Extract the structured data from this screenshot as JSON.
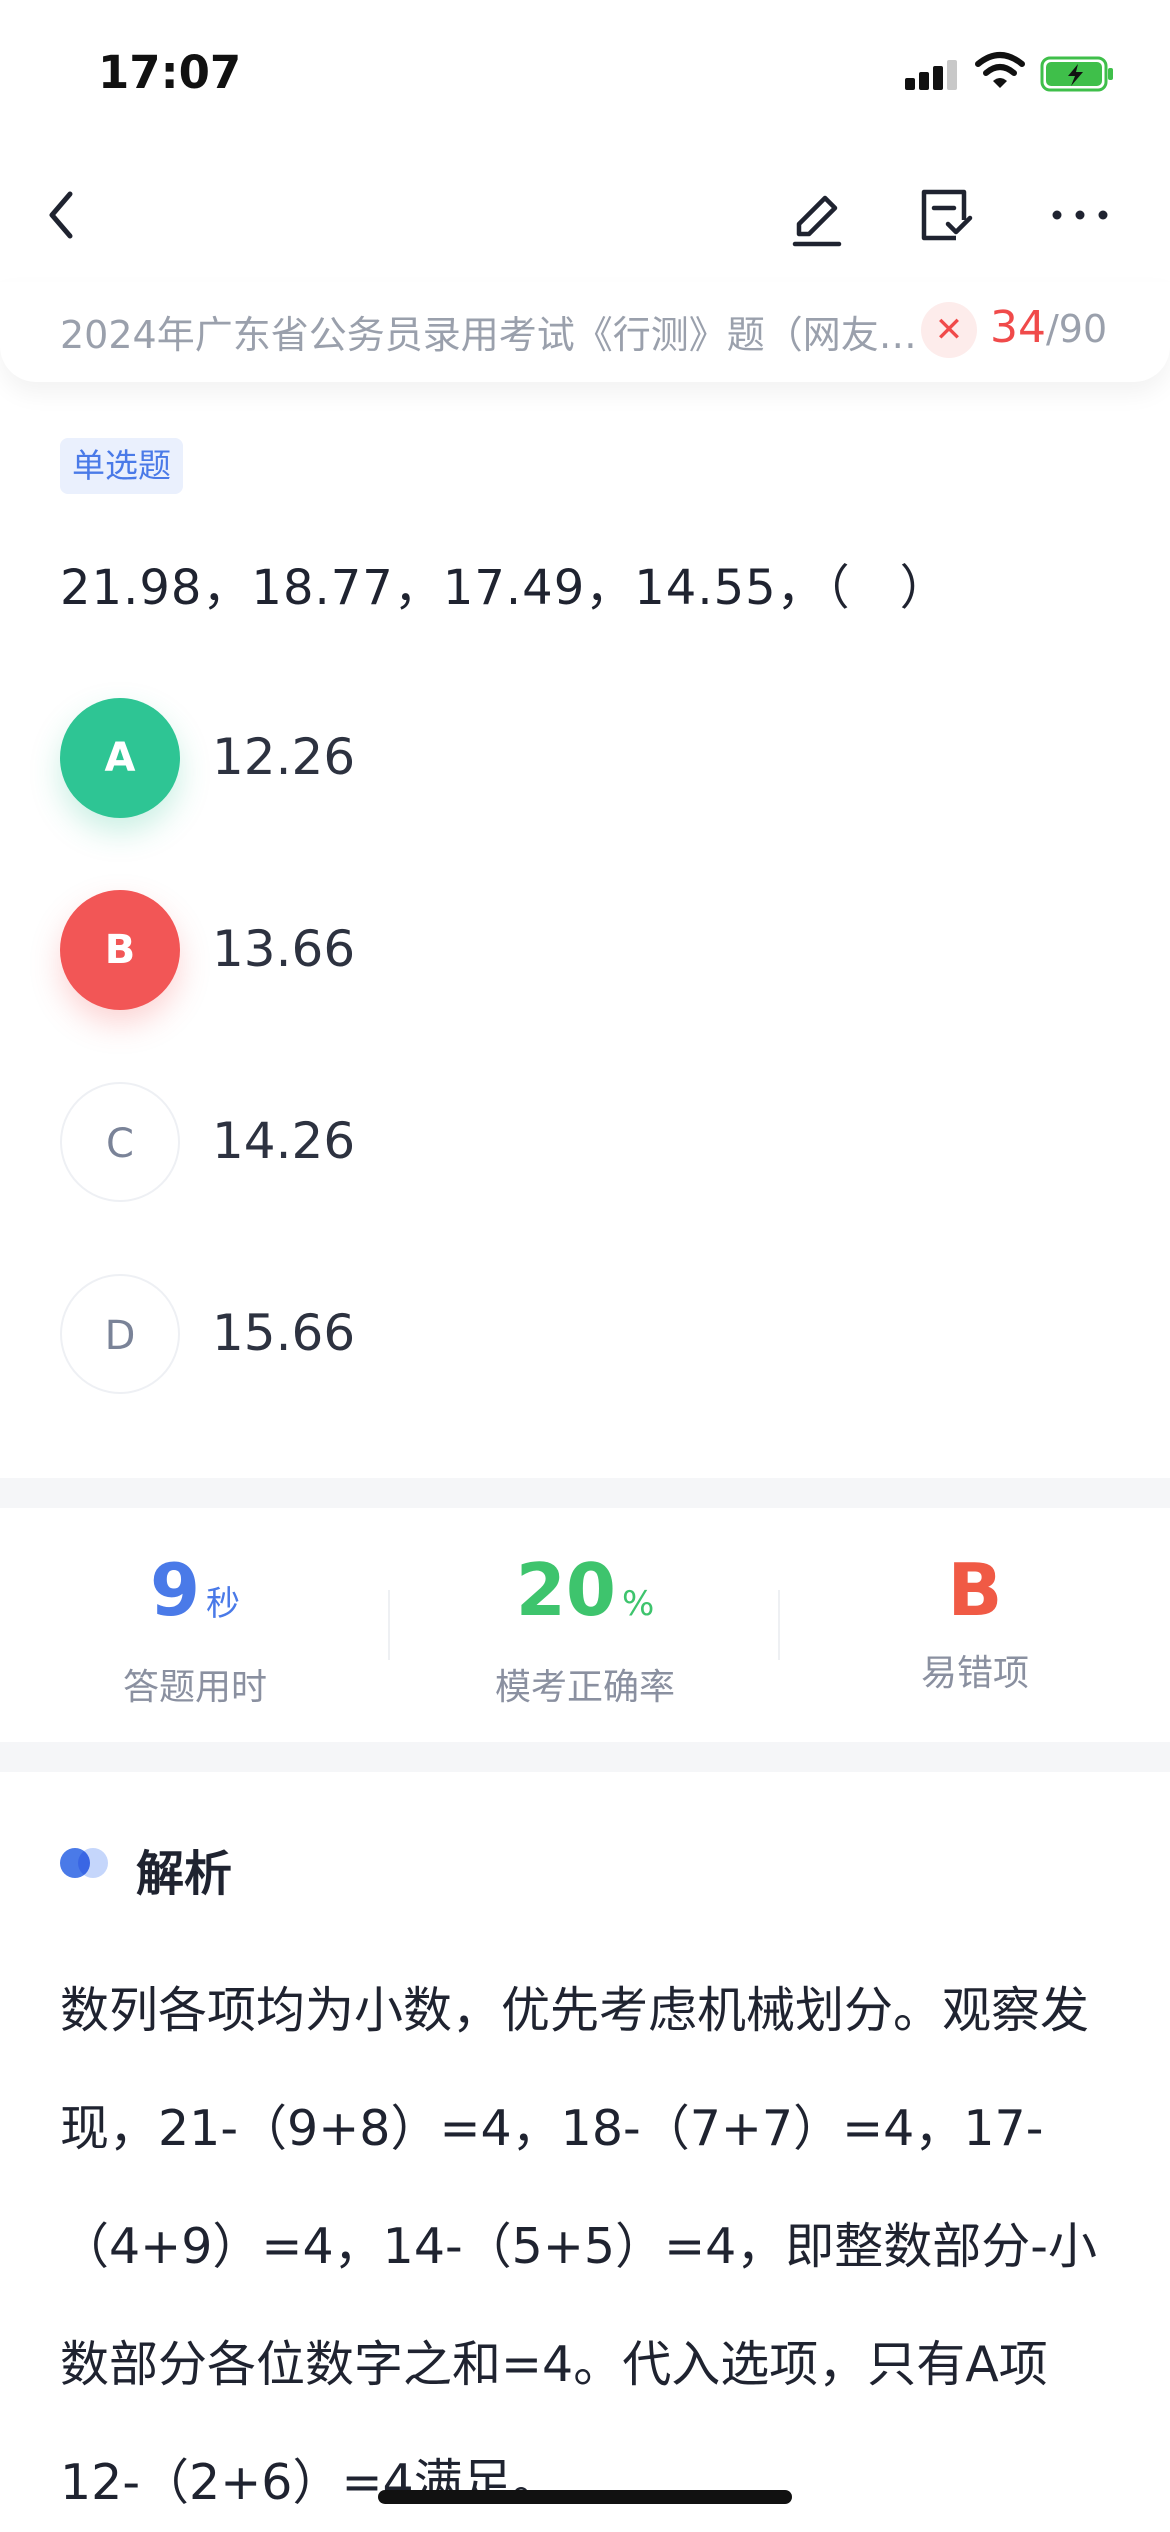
{
  "status_bar": {
    "time": "17:07"
  },
  "nav": {
    "icons": [
      "back-icon",
      "edit-icon",
      "answer-card-icon",
      "more-icon"
    ]
  },
  "paper": {
    "title": "2024年广东省公务员录用考试《行测》题（网友回忆版）",
    "title_visible": "2024年广东省公务员录用考试《行测》题（网友…",
    "current": "34",
    "total": "/90"
  },
  "question": {
    "type": "单选题",
    "text": "21.98，18.77，17.49，14.55，（　）",
    "options": [
      {
        "letter": "A",
        "value": "12.26",
        "state": "correct"
      },
      {
        "letter": "B",
        "value": "13.66",
        "state": "wrong"
      },
      {
        "letter": "C",
        "value": "14.26",
        "state": "normal"
      },
      {
        "letter": "D",
        "value": "15.66",
        "state": "normal"
      }
    ]
  },
  "stats": {
    "time": {
      "value": "9",
      "unit": "秒",
      "label": "答题用时",
      "color": "#4a7ae8"
    },
    "accuracy": {
      "value": "20",
      "unit": "%",
      "label": "模考正确率",
      "color": "#3ec46d"
    },
    "wrong": {
      "value": "B",
      "label": "易错项",
      "color": "#f05a45"
    }
  },
  "analysis": {
    "title": "解析",
    "body": "数列各项均为小数，优先考虑机械划分。观察发现，21-（9+8）=4，18-（7+7）=4，17-（4+9）=4，14-（5+5）=4，即整数部分-小数部分各位数字之和=4。代入选项，只有A项12-（2+6）=4满足。"
  }
}
